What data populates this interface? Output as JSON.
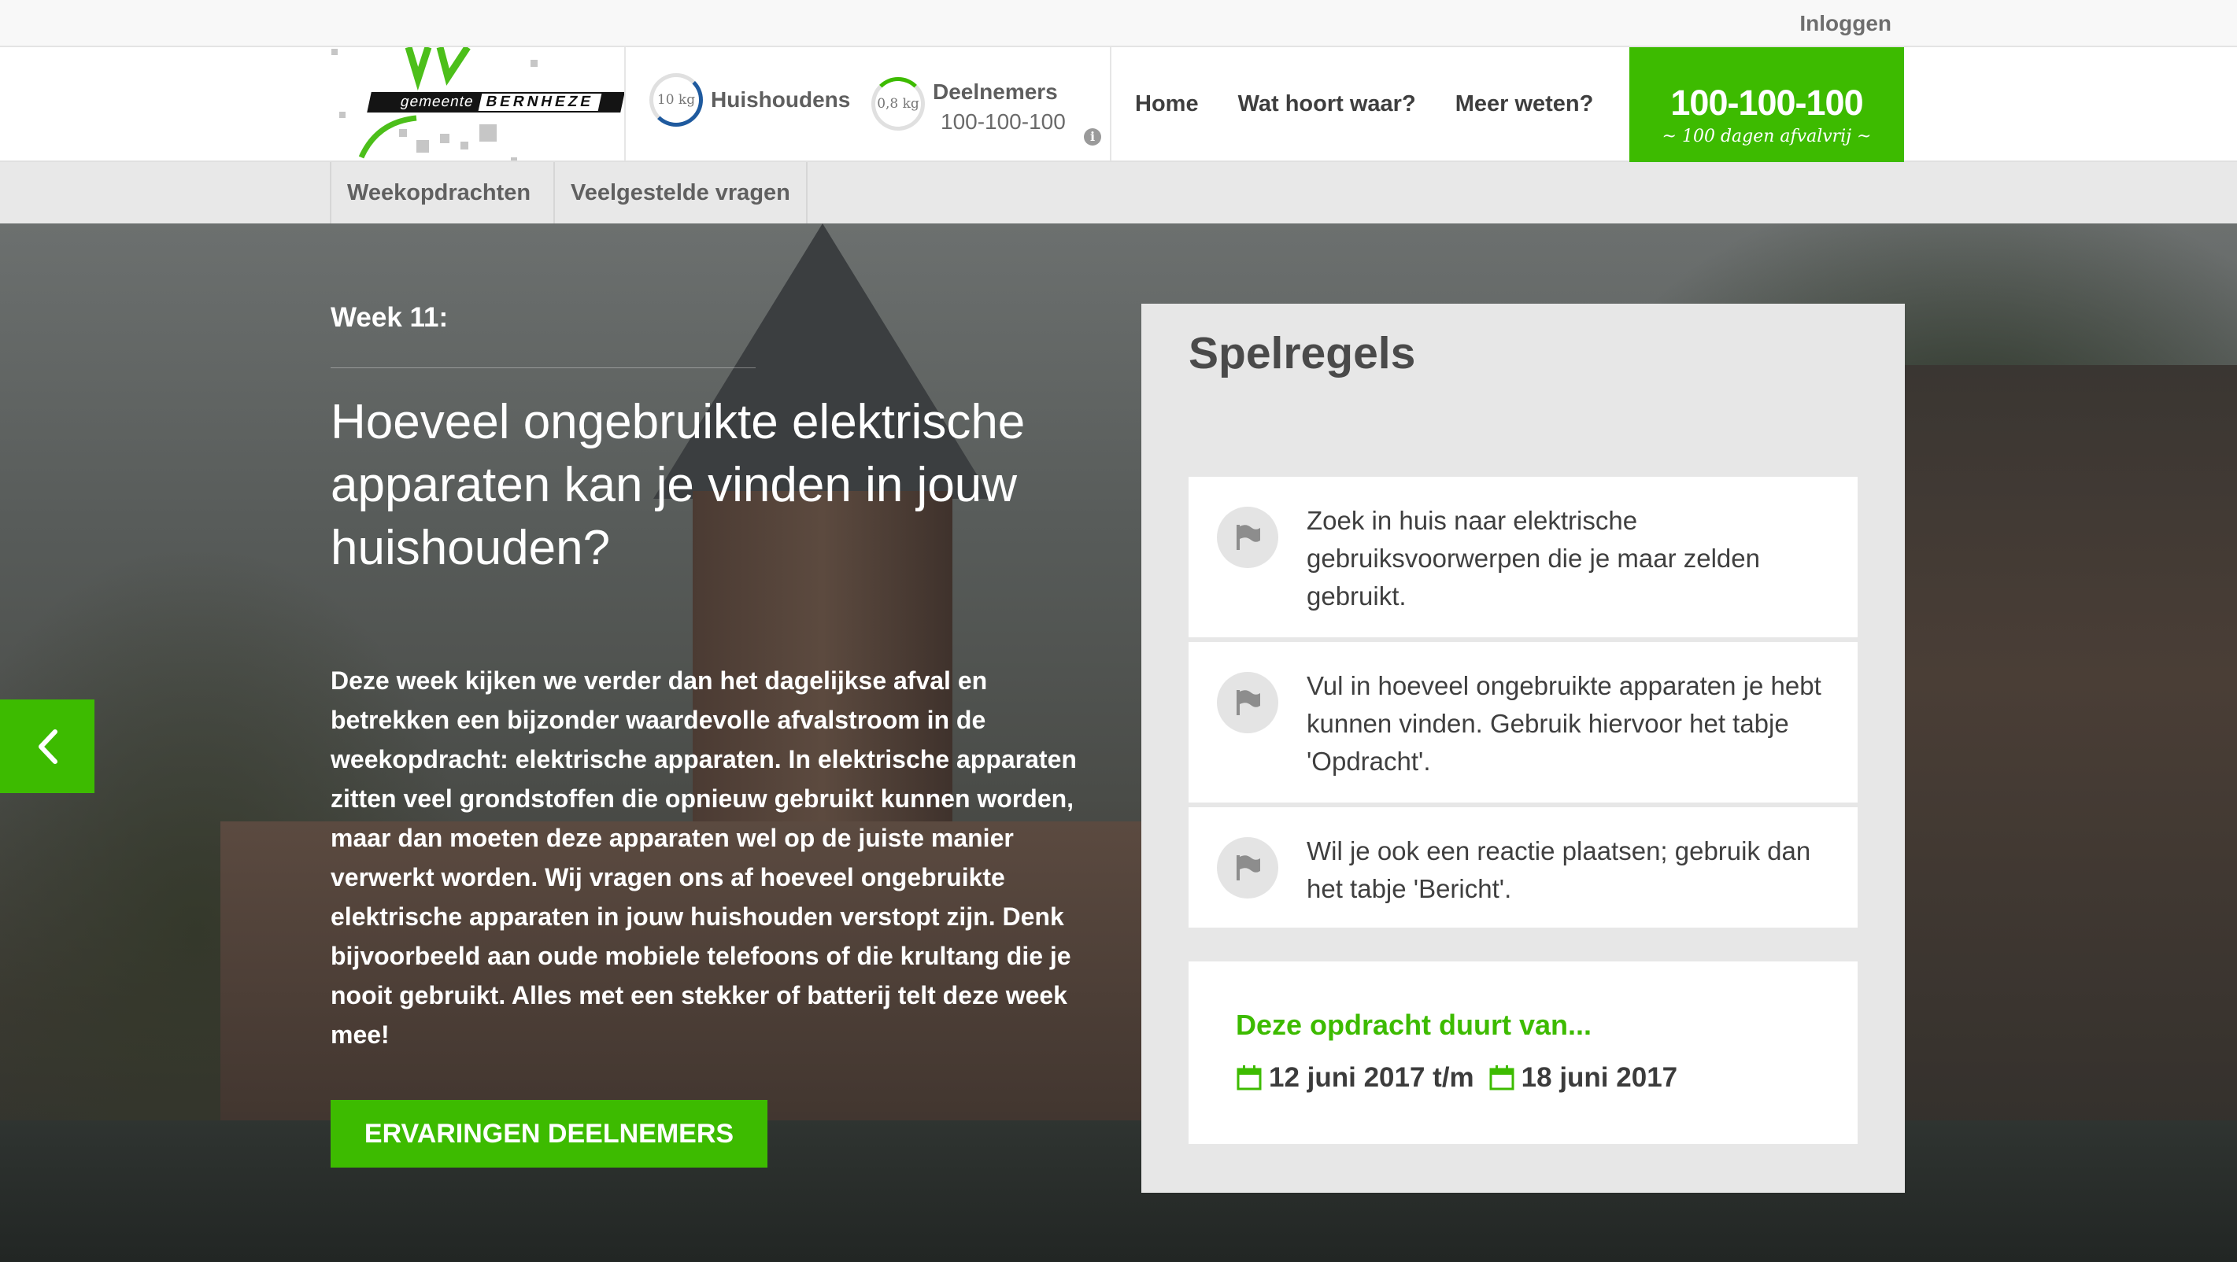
{
  "topbar": {
    "login_label": "Inloggen"
  },
  "logo": {
    "left_text": "gemeente",
    "right_text": "BERNHEZE"
  },
  "stats": {
    "households": {
      "ring_value": "10 kg",
      "label": "Huishoudens"
    },
    "participants": {
      "ring_value": "0,8 kg",
      "label": "Deelnemers",
      "sub": "100-100-100"
    }
  },
  "nav": {
    "items": [
      "Home",
      "Wat hoort waar?",
      "Meer weten?"
    ]
  },
  "brand": {
    "title": "100-100-100",
    "tagline": "100 dagen afvalvrij"
  },
  "subnav": {
    "tabs": [
      "Weekopdrachten",
      "Veelgestelde vragen"
    ]
  },
  "hero": {
    "week": "Week 11:",
    "title": "Hoeveel ongebruikte elektrische apparaten kan je vinden in jouw huishouden?",
    "body": "Deze week kijken we verder dan het dagelijkse afval en betrekken een bijzonder waardevolle afvalstroom in de weekopdracht: elektrische apparaten. In elektrische apparaten zitten veel grondstoffen die opnieuw gebruikt kunnen worden, maar dan moeten deze apparaten wel op de juiste manier verwerkt worden. Wij vragen ons af hoeveel ongebruikte elektrische apparaten in jouw huishouden verstopt zijn. Denk bijvoorbeeld aan oude mobiele telefoons of die krultang die je nooit gebruikt. Alles met een stekker of batterij telt deze week mee!",
    "cta": "ERVARINGEN DEELNEMERS"
  },
  "rules": {
    "title": "Spelregels",
    "items": [
      "Zoek in huis naar elektrische gebruiksvoorwerpen die je maar zelden gebruikt.",
      "Vul in hoeveel ongebruikte apparaten je hebt kunnen vinden. Gebruik hiervoor het tabje 'Opdracht'.",
      "Wil je ook een reactie plaatsen; gebruik dan het tabje 'Bericht'."
    ]
  },
  "duration": {
    "heading": "Deze opdracht duurt van...",
    "start": "12 juni 2017 t/m",
    "end": "18 juni 2017"
  },
  "colors": {
    "accent": "#3dbb00",
    "ring_blue": "#1f5a9e"
  }
}
